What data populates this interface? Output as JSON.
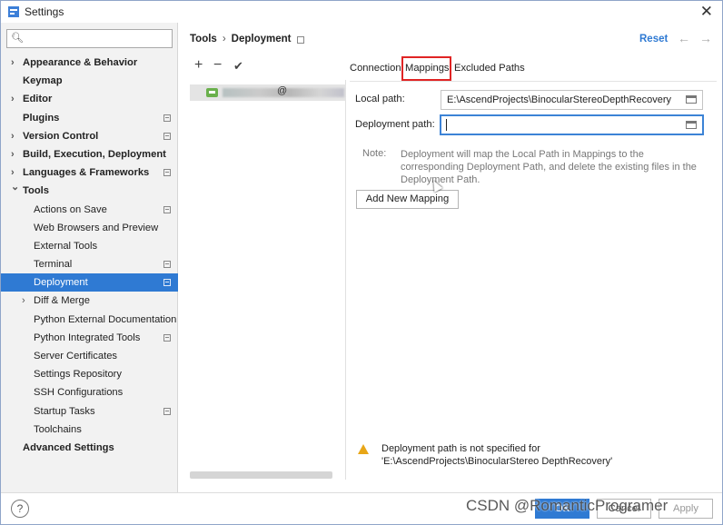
{
  "window": {
    "title": "Settings"
  },
  "search": {
    "placeholder": ""
  },
  "sidebar": {
    "items": [
      {
        "label": "Appearance & Behavior",
        "bold": true,
        "chevron": "right",
        "indent": 0,
        "badge": false
      },
      {
        "label": "Keymap",
        "bold": true,
        "chevron": "",
        "indent": 0,
        "badge": false
      },
      {
        "label": "Editor",
        "bold": true,
        "chevron": "right",
        "indent": 0,
        "badge": false
      },
      {
        "label": "Plugins",
        "bold": true,
        "chevron": "",
        "indent": 0,
        "badge": true
      },
      {
        "label": "Version Control",
        "bold": true,
        "chevron": "right",
        "indent": 0,
        "badge": true
      },
      {
        "label": "Build, Execution, Deployment",
        "bold": true,
        "chevron": "right",
        "indent": 0,
        "badge": false
      },
      {
        "label": "Languages & Frameworks",
        "bold": true,
        "chevron": "right",
        "indent": 0,
        "badge": true
      },
      {
        "label": "Tools",
        "bold": true,
        "chevron": "down",
        "indent": 0,
        "badge": false
      },
      {
        "label": "Actions on Save",
        "bold": false,
        "chevron": "",
        "indent": 1,
        "badge": true
      },
      {
        "label": "Web Browsers and Preview",
        "bold": false,
        "chevron": "",
        "indent": 1,
        "badge": false
      },
      {
        "label": "External Tools",
        "bold": false,
        "chevron": "",
        "indent": 1,
        "badge": false
      },
      {
        "label": "Terminal",
        "bold": false,
        "chevron": "",
        "indent": 1,
        "badge": true
      },
      {
        "label": "Deployment",
        "bold": false,
        "chevron": "",
        "indent": 1,
        "badge": true,
        "selected": true
      },
      {
        "label": "Diff & Merge",
        "bold": false,
        "chevron": "right",
        "indent": 1,
        "badge": false
      },
      {
        "label": "Python External Documentation",
        "bold": false,
        "chevron": "",
        "indent": 1,
        "badge": false
      },
      {
        "label": "Python Integrated Tools",
        "bold": false,
        "chevron": "",
        "indent": 1,
        "badge": true
      },
      {
        "label": "Server Certificates",
        "bold": false,
        "chevron": "",
        "indent": 1,
        "badge": false
      },
      {
        "label": "Settings Repository",
        "bold": false,
        "chevron": "",
        "indent": 1,
        "badge": false
      },
      {
        "label": "SSH Configurations",
        "bold": false,
        "chevron": "",
        "indent": 1,
        "badge": false
      },
      {
        "label": "Startup Tasks",
        "bold": false,
        "chevron": "",
        "indent": 1,
        "badge": true
      },
      {
        "label": "Toolchains",
        "bold": false,
        "chevron": "",
        "indent": 1,
        "badge": false
      },
      {
        "label": "Advanced Settings",
        "bold": true,
        "chevron": "",
        "indent": 0,
        "badge": false
      }
    ]
  },
  "header": {
    "crumb_parent": "Tools",
    "crumb_separator": "›",
    "crumb_current": "Deployment",
    "reset_label": "Reset",
    "back_arrow": "←",
    "forward_arrow": "→"
  },
  "server_toolbar": {
    "add": "+",
    "remove": "−",
    "check": "✔"
  },
  "server_list": {
    "at_sign": "@"
  },
  "tabs": [
    "Connection",
    "Mappings",
    "Excluded Paths"
  ],
  "active_tab": "Mappings",
  "form": {
    "local_path_label": "Local path:",
    "local_path_value": "E:\\AscendProjects\\BinocularStereoDepthRecovery",
    "deployment_path_label": "Deployment path:",
    "deployment_path_value": "",
    "note_label": "Note:",
    "note_text": "Deployment will map the Local Path in Mappings to the corresponding Deployment Path, and delete the existing files in the Deployment Path.",
    "add_mapping_label": "Add New Mapping"
  },
  "warning": {
    "text": "Deployment path is not specified for 'E:\\AscendProjects\\BinocularStereo DepthRecovery'"
  },
  "footer": {
    "help_label": "?",
    "ok_label": "OK",
    "cancel_label": "Cancel",
    "apply_label": "Apply",
    "watermark": "CSDN @RomanticProgramer"
  },
  "colors": {
    "accent": "#2f7ad3",
    "highlight_box": "#e02424",
    "warning": "#e8a617"
  }
}
